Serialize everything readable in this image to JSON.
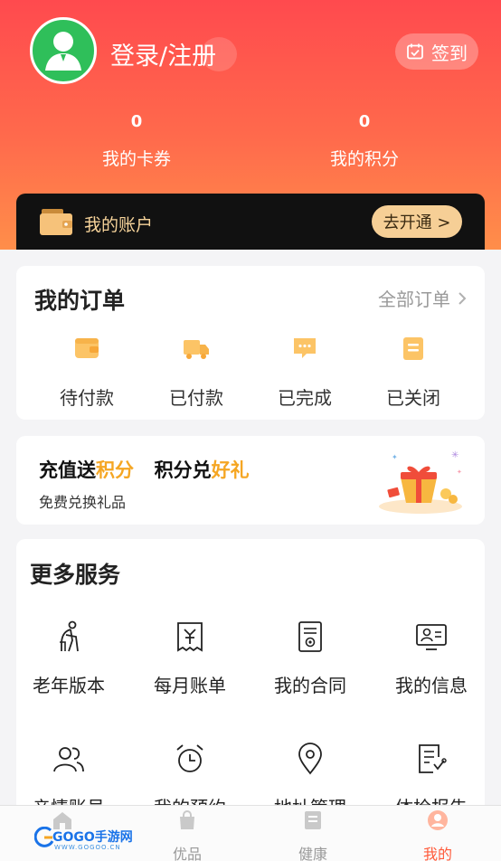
{
  "header": {
    "login_label": "登录/注册",
    "signin_label": "签到",
    "stats": [
      {
        "value": "0",
        "label": "我的卡券"
      },
      {
        "value": "0",
        "label": "我的积分"
      }
    ]
  },
  "account": {
    "label": "我的账户",
    "open_button": "去开通 >"
  },
  "orders": {
    "title": "我的订单",
    "all_link": "全部订单",
    "items": [
      {
        "label": "待付款",
        "icon": "wallet-icon"
      },
      {
        "label": "已付款",
        "icon": "delivery-truck-icon"
      },
      {
        "label": "已完成",
        "icon": "chat-bubble-icon"
      },
      {
        "label": "已关闭",
        "icon": "clipboard-icon"
      }
    ]
  },
  "promo": {
    "part1": "充值送",
    "part1_highlight": "积分",
    "part2": "积分兑",
    "part2_highlight": "好礼",
    "subtitle": "免费兑换礼品"
  },
  "services": {
    "title": "更多服务",
    "items": [
      {
        "label": "老年版本",
        "icon": "elderly-icon"
      },
      {
        "label": "每月账单",
        "icon": "bill-icon"
      },
      {
        "label": "我的合同",
        "icon": "contract-icon"
      },
      {
        "label": "我的信息",
        "icon": "profile-screen-icon"
      },
      {
        "label": "亲情账号",
        "icon": "family-icon"
      },
      {
        "label": "我的预约",
        "icon": "alarm-clock-icon"
      },
      {
        "label": "地址管理",
        "icon": "location-pin-icon"
      },
      {
        "label": "体检报告",
        "icon": "report-icon"
      }
    ]
  },
  "tabbar": {
    "items": [
      {
        "label": "",
        "icon": "home-icon"
      },
      {
        "label": "优品",
        "icon": "shopping-bag-icon"
      },
      {
        "label": "健康",
        "icon": "health-icon"
      },
      {
        "label": "我的",
        "icon": "user-icon"
      }
    ],
    "active_index": 3
  },
  "watermark": {
    "text": "GOGO手游网",
    "sub": "WWW.GOGOO.CN"
  },
  "colors": {
    "header_top": "#ff4a4e",
    "header_bottom": "#ff8e4a",
    "accent": "#f5a623",
    "active_tab": "#ff5a3a",
    "account_bg": "#111111",
    "account_text": "#f6d39a"
  }
}
